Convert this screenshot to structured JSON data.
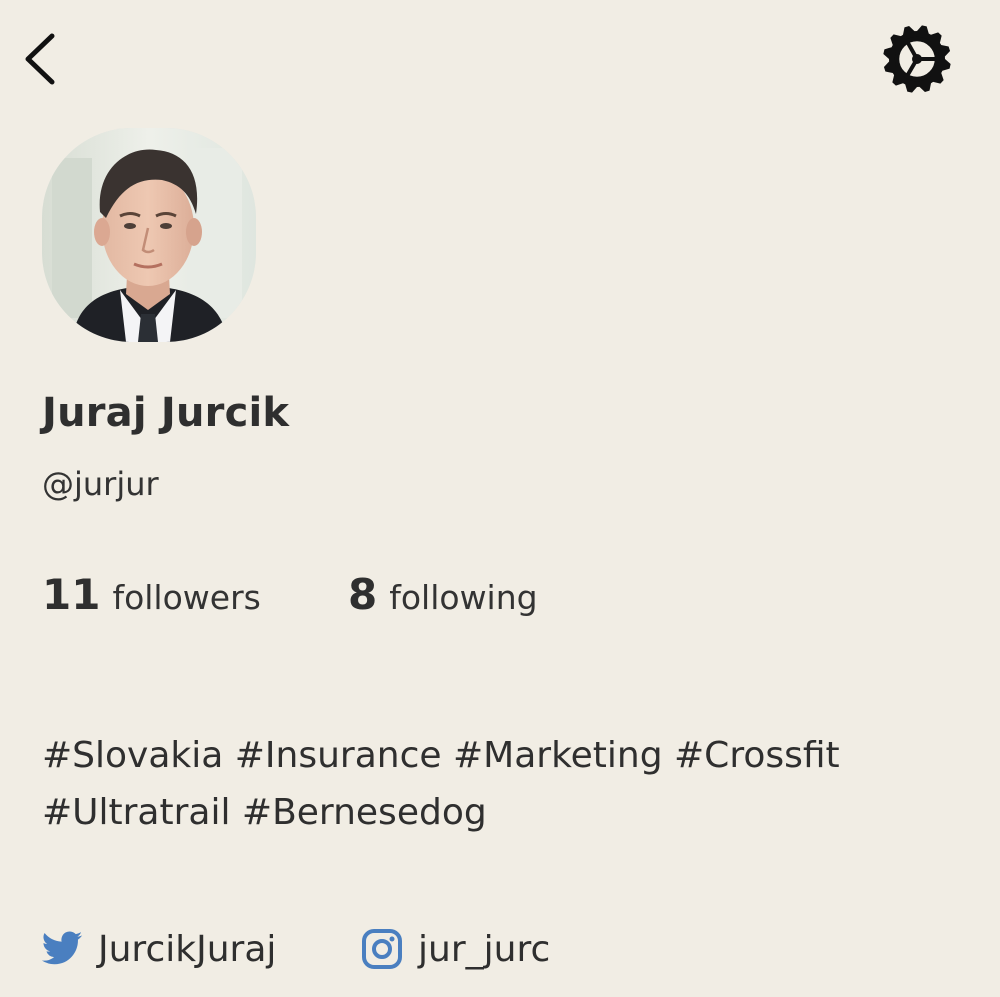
{
  "header": {
    "back_icon": "chevron-left-icon",
    "settings_icon": "gear-icon"
  },
  "profile": {
    "avatar_icon": "profile-photo",
    "name": "Juraj Jurcik",
    "handle": "@jurjur"
  },
  "stats": {
    "followers": {
      "count": "11",
      "label": "followers"
    },
    "following": {
      "count": "8",
      "label": "following"
    }
  },
  "bio": {
    "lines": [
      "#Slovakia #Insurance #Marketing #Crossfit",
      "#Ultratrail #Bernesedog"
    ]
  },
  "social": {
    "twitter": {
      "icon": "twitter-icon",
      "label": "JurcikJuraj",
      "color": "#4a7fc0"
    },
    "instagram": {
      "icon": "instagram-icon",
      "label": "jur_jurc",
      "color": "#4a7fc0"
    }
  },
  "colors": {
    "background": "#f1ede4",
    "text": "#2f2f2f",
    "accent": "#4a7fc0"
  }
}
